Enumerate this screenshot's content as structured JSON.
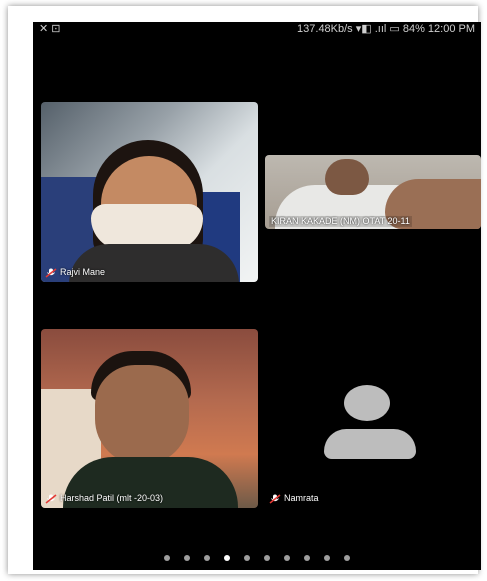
{
  "status_bar": {
    "left_icons": "✕ ⊡",
    "right_text": "137.48Kb/s ▾◧ .ııl ▭ 84% 12:00 PM"
  },
  "participants": [
    {
      "name": "Rajvi Mane",
      "muted": true
    },
    {
      "name": "KIRAN KAKADE (NM) OTAT 20-11",
      "muted": false
    },
    {
      "name": "Harshad Patil (mlt -20-03)",
      "muted": true
    },
    {
      "name": "Namrata",
      "muted": true
    }
  ],
  "pagination": {
    "total": 10,
    "active_index": 3
  },
  "colors": {
    "screen_bg": "#000000",
    "avatar": "#bdbdbd",
    "dot_inactive": "#9e9e9e",
    "dot_active": "#ffffff"
  },
  "icons": {
    "muted": "mic-off-icon",
    "avatar": "person-avatar-icon"
  }
}
